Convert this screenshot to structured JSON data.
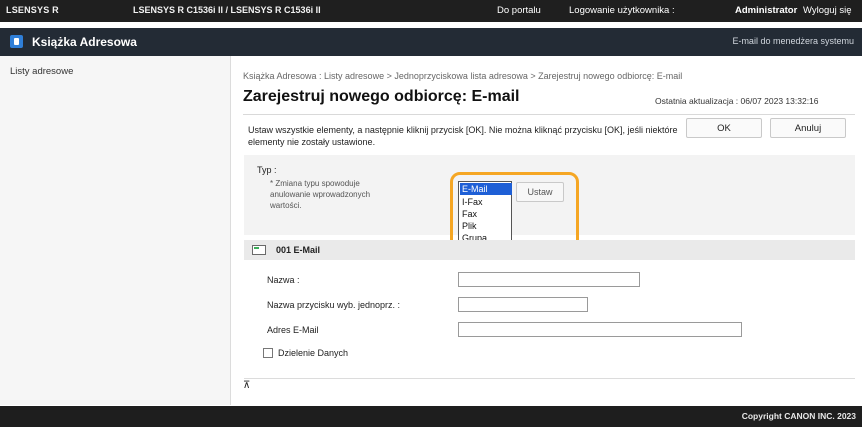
{
  "topbar": {
    "left_text": "LSENSYS R",
    "device_text": "LSENSYS R C1536i II / LSENSYS R C1536i II",
    "portal_link": "Do portalu",
    "login_label": "Logowanie użytkownika :",
    "user_name": "Administrator",
    "logout_link": "Wyloguj się"
  },
  "header": {
    "title": "Książka Adresowa",
    "email_admin_link": "E-mail do menedżera systemu"
  },
  "sidebar": {
    "items": [
      {
        "label": "Listy adresowe"
      }
    ]
  },
  "main": {
    "breadcrumb": "Książka Adresowa : Listy adresowe > Jednoprzyciskowa lista adresowa > Zarejestruj nowego odbiorcę: E-mail",
    "page_title": "Zarejestruj nowego odbiorcę: E-mail",
    "last_update": "Ostatnia aktualizacja : 06/07 2023 13:32:16",
    "instructions": "Ustaw wszystkie elementy, a następnie kliknij przycisk [OK]. Nie można kliknąć przycisku [OK], jeśli niektóre elementy nie zostały ustawione.",
    "ok_label": "OK",
    "cancel_label": "Anuluj"
  },
  "type_section": {
    "label": "Typ :",
    "note": "* Zmiana typu spowoduje anulowanie wprowadzonych wartości.",
    "options": [
      "E-Mail",
      "I-Fax",
      "Fax",
      "Plik",
      "Grupa"
    ],
    "selected": "E-Mail",
    "set_button": "Ustaw"
  },
  "entry": {
    "header": "001 E-Mail",
    "name_label": "Nazwa :",
    "button_name_label": "Nazwa przycisku wyb. jednoprz. :",
    "email_label": "Adres E-Mail",
    "name_value": "",
    "button_name_value": "",
    "email_value": "",
    "sharing_label": "Dzielenie Danych",
    "sharing_checked": false
  },
  "footer": {
    "copyright": "Copyright CANON INC. 2023"
  }
}
